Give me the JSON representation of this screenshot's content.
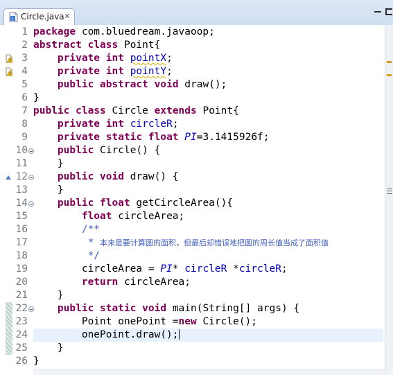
{
  "tab": {
    "title": "Circle.java",
    "close_glyph": "✕",
    "icon": "java-file-icon"
  },
  "window_controls": {
    "minimize": "minimize-icon",
    "maximize": "maximize-icon"
  },
  "colors": {
    "keyword": "#7f0055",
    "field": "#0000c0",
    "comment": "#3f5fbf",
    "line_number": "#787878",
    "current_line": "#e8f2fe",
    "tab_strip": "#dde8f6"
  },
  "editor": {
    "current_line": 24,
    "lines": [
      {
        "n": "1",
        "tokens": [
          [
            "kw",
            "package"
          ],
          [
            "t",
            " com.bluedream.javaoop;"
          ]
        ]
      },
      {
        "n": "2",
        "tokens": [
          [
            "kw",
            "abstract"
          ],
          [
            "t",
            " "
          ],
          [
            "kw",
            "class"
          ],
          [
            "t",
            " Point{"
          ]
        ]
      },
      {
        "n": "3",
        "marker": "warning",
        "tokens": [
          [
            "t",
            "    "
          ],
          [
            "kw",
            "private"
          ],
          [
            "t",
            " "
          ],
          [
            "kw",
            "int"
          ],
          [
            "t",
            " "
          ],
          [
            "fldw",
            "pointX"
          ],
          [
            "t",
            ";"
          ]
        ]
      },
      {
        "n": "4",
        "marker": "warning",
        "tokens": [
          [
            "t",
            "    "
          ],
          [
            "kw",
            "private"
          ],
          [
            "t",
            " "
          ],
          [
            "kw",
            "int"
          ],
          [
            "t",
            " "
          ],
          [
            "fldw",
            "pointY"
          ],
          [
            "t",
            ";"
          ]
        ]
      },
      {
        "n": "5",
        "tokens": [
          [
            "t",
            "    "
          ],
          [
            "kw",
            "public"
          ],
          [
            "t",
            " "
          ],
          [
            "kw",
            "abstract"
          ],
          [
            "t",
            " "
          ],
          [
            "kw",
            "void"
          ],
          [
            "t",
            " draw();"
          ]
        ]
      },
      {
        "n": "6",
        "tokens": [
          [
            "t",
            "}"
          ]
        ]
      },
      {
        "n": "7",
        "tokens": [
          [
            "kw",
            "public"
          ],
          [
            "t",
            " "
          ],
          [
            "kw",
            "class"
          ],
          [
            "t",
            " Circle "
          ],
          [
            "kw",
            "extends"
          ],
          [
            "t",
            " Point{"
          ]
        ]
      },
      {
        "n": "8",
        "tokens": [
          [
            "t",
            "    "
          ],
          [
            "kw",
            "private"
          ],
          [
            "t",
            " "
          ],
          [
            "kw",
            "int"
          ],
          [
            "t",
            " "
          ],
          [
            "fld",
            "circleR"
          ],
          [
            "t",
            ";"
          ]
        ]
      },
      {
        "n": "9",
        "tokens": [
          [
            "t",
            "    "
          ],
          [
            "kw",
            "private"
          ],
          [
            "t",
            " "
          ],
          [
            "kw",
            "static"
          ],
          [
            "t",
            " "
          ],
          [
            "kw",
            "float"
          ],
          [
            "t",
            " "
          ],
          [
            "sfld",
            "PI"
          ],
          [
            "t",
            "=3.1415926f;"
          ]
        ]
      },
      {
        "n": "10",
        "fold": true,
        "tokens": [
          [
            "t",
            "    "
          ],
          [
            "kw",
            "public"
          ],
          [
            "t",
            " Circle() {"
          ]
        ]
      },
      {
        "n": "11",
        "tokens": [
          [
            "t",
            "    }"
          ]
        ]
      },
      {
        "n": "12",
        "fold": true,
        "marker": "override",
        "tokens": [
          [
            "t",
            "    "
          ],
          [
            "kw",
            "public"
          ],
          [
            "t",
            " "
          ],
          [
            "kw",
            "void"
          ],
          [
            "t",
            " draw() {"
          ]
        ]
      },
      {
        "n": "13",
        "tokens": [
          [
            "t",
            "    }"
          ]
        ]
      },
      {
        "n": "14",
        "fold": true,
        "tokens": [
          [
            "t",
            "    "
          ],
          [
            "kw",
            "public"
          ],
          [
            "t",
            " "
          ],
          [
            "kw",
            "float"
          ],
          [
            "t",
            " getCircleArea(){"
          ]
        ]
      },
      {
        "n": "15",
        "tokens": [
          [
            "t",
            "        "
          ],
          [
            "kw",
            "float"
          ],
          [
            "t",
            " circleArea;"
          ]
        ]
      },
      {
        "n": "16",
        "tokens": [
          [
            "t",
            "        "
          ],
          [
            "cmt",
            "/**"
          ]
        ]
      },
      {
        "n": "17",
        "tokens": [
          [
            "t",
            "        "
          ],
          [
            "cmt",
            " * "
          ],
          [
            "cjk",
            "本来是要计算圆的面积，但最后却错误地把圆的周长值当成了面积值"
          ]
        ]
      },
      {
        "n": "18",
        "tokens": [
          [
            "t",
            "        "
          ],
          [
            "cmt",
            " */"
          ]
        ]
      },
      {
        "n": "19",
        "tokens": [
          [
            "t",
            "        circleArea = "
          ],
          [
            "sfld",
            "PI"
          ],
          [
            "t",
            "* "
          ],
          [
            "fld",
            "circleR"
          ],
          [
            "t",
            " *"
          ],
          [
            "fld",
            "circleR"
          ],
          [
            "t",
            ";"
          ]
        ]
      },
      {
        "n": "20",
        "tokens": [
          [
            "t",
            "        "
          ],
          [
            "kw",
            "return"
          ],
          [
            "t",
            " circleArea;"
          ]
        ]
      },
      {
        "n": "21",
        "tokens": [
          [
            "t",
            "    }"
          ]
        ]
      },
      {
        "n": "22",
        "fold": true,
        "marker": "changed",
        "tokens": [
          [
            "t",
            "    "
          ],
          [
            "kw",
            "public"
          ],
          [
            "t",
            " "
          ],
          [
            "kw",
            "static"
          ],
          [
            "t",
            " "
          ],
          [
            "kw",
            "void"
          ],
          [
            "t",
            " main(String[] args) {"
          ]
        ]
      },
      {
        "n": "23",
        "marker": "changed",
        "tokens": [
          [
            "t",
            "        Point onePoint ="
          ],
          [
            "kw",
            "new"
          ],
          [
            "t",
            " Circle();"
          ]
        ]
      },
      {
        "n": "24",
        "marker": "changed",
        "tokens": [
          [
            "t",
            "        onePoint.draw();"
          ],
          [
            "caret",
            ""
          ]
        ]
      },
      {
        "n": "25",
        "marker": "changed",
        "tokens": [
          [
            "t",
            "    }"
          ]
        ]
      },
      {
        "n": "26",
        "tokens": [
          [
            "t",
            "}"
          ]
        ]
      }
    ]
  }
}
